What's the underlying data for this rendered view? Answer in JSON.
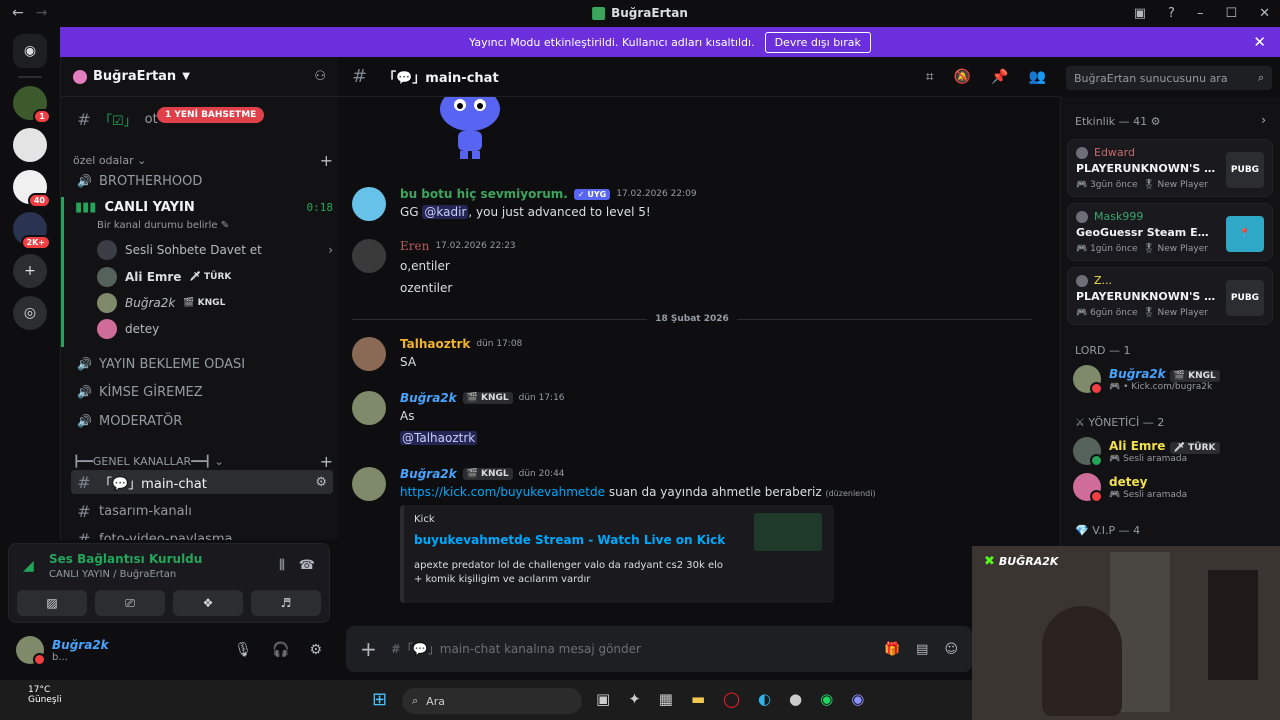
{
  "window": {
    "title": "BuğraErtan"
  },
  "banner": {
    "text": "Yayıncı Modu etkinleştirildi. Kullanıcı adları kısaltıldı.",
    "button": "Devre dışı bırak"
  },
  "rail": {
    "badges": [
      "1",
      "40",
      "2K+"
    ]
  },
  "guild": {
    "name": "BuğraErtan",
    "mention_pill": "1 YENİ BAHSETME",
    "top_channel": "ot",
    "category_private": "özel odalar",
    "voice_channels_top": [
      "BROTHERHOOD"
    ],
    "live_channel": "CANLI YAYIN",
    "live_timer": "0:18",
    "live_status": "Bir kanal durumu belirle",
    "voice_users": [
      {
        "name": "Sesli Sohbete Davet et",
        "tag": ""
      },
      {
        "name": "Ali Emre",
        "tag": "TÜRK"
      },
      {
        "name": "Buğra2k",
        "tag": "KNGL"
      },
      {
        "name": "detey",
        "tag": ""
      }
    ],
    "voice_channels_bottom": [
      "YAYIN BEKLEME ODASI",
      "KİMSE GİREMEZ",
      "MODERATÖR"
    ],
    "category_general": "┣━━GENEL KANALLAR━━┫",
    "text_channels": [
      "「💬」main-chat",
      "tasarım-kanalı",
      "foto-video-paylaşma"
    ]
  },
  "voice_panel": {
    "status": "Ses Bağlantısı Kuruldu",
    "sub": "CANLI YAYIN / BuğraErtan"
  },
  "user_panel": {
    "name": "Buğra2k",
    "status": "b..."
  },
  "chat": {
    "channel": "「💬」main-chat",
    "search_placeholder": "BuğraErtan sunucusunu ara",
    "composer_placeholder": "#「💬」main-chat kanalına mesaj gönder",
    "date_divider": "18 Şubat 2026",
    "messages": [
      {
        "author": "bu botu hiç sevmiyorum.",
        "badge": "UYG",
        "time": "17.02.2026 22:09",
        "pre": "GG ",
        "mention": "@kadir",
        "post": ", you just advanced to level 5!"
      },
      {
        "author": "Eren",
        "time": "17.02.2026 22:23",
        "lines": [
          "o,entiler",
          "ozentiler"
        ]
      },
      {
        "author": "Talhaoztrk",
        "time": "dün 17:08",
        "lines": [
          "SA"
        ]
      },
      {
        "author": "Buğra2k",
        "badge": "KNGL",
        "time": "dün 17:16",
        "lines": [
          "As"
        ],
        "mention": "@Talhaoztrk"
      },
      {
        "author": "Buğra2k",
        "badge": "KNGL",
        "time": "dün 20:44",
        "link": "https://kick.com/buyukevahmetde",
        "post": " suan da yayında ahmetle beraberiz",
        "edited": "(düzenlendi)"
      }
    ],
    "embed": {
      "provider": "Kick",
      "title": "buyukevahmetde Stream - Watch Live on Kick",
      "description": "apexte predator lol de challenger valo da radyant cs2 30k elo + komik kişiligim ve acılarım vardır"
    }
  },
  "members": {
    "activity_title": "Etkinlik — 41",
    "activities": [
      {
        "user": "Edward",
        "game": "PLAYERUNKNOWN'S BATT...",
        "ago": "3gün önce",
        "tag": "New Player",
        "icon": "PUBG"
      },
      {
        "user": "Mask999",
        "game": "GeoGuessr Steam Edition",
        "ago": "1gün önce",
        "tag": "New Player",
        "icon": "map-pin"
      },
      {
        "user": "Z...",
        "game": "PLAYERUNKNOWN'S BATT...",
        "ago": "6gün önce",
        "tag": "New Player",
        "icon": "PUBG"
      }
    ],
    "groups": [
      {
        "title": "LORD — 1",
        "members": [
          {
            "name": "Buğra2k",
            "tag": "KNGL",
            "sub": "Kick.com/bugra2k"
          }
        ]
      },
      {
        "title": "YÖNETİCİ — 2",
        "members": [
          {
            "name": "Ali Emre",
            "tag": "TÜRK",
            "sub": "Sesli aramada"
          },
          {
            "name": "detey",
            "tag": "",
            "sub": "Sesli aramada"
          }
        ]
      },
      {
        "title": "V.I.P — 4",
        "members": []
      }
    ]
  },
  "webcam": {
    "logo": "BUĞRA2K"
  },
  "taskbar": {
    "temp": "17°C",
    "weather_sub": "Güneşli",
    "search": "Ara"
  },
  "colors": {
    "banner": "#6b2fdc",
    "bot_name": "#3ba55c",
    "talha": "#f0b232",
    "bugra": "#46a3ff",
    "eren": "#b85c5c",
    "link": "#00a8fc"
  }
}
